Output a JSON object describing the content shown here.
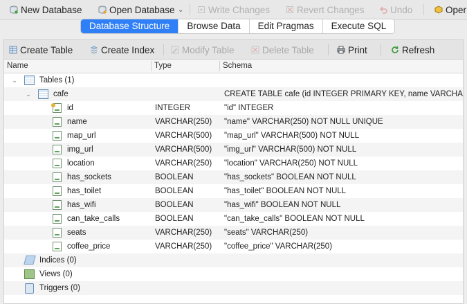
{
  "toolbar": {
    "new_database": "New Database",
    "open_database": "Open Database",
    "write_changes": "Write Changes",
    "revert_changes": "Revert Changes",
    "undo": "Undo",
    "open_project": "Oper"
  },
  "tabs": [
    "Database Structure",
    "Browse Data",
    "Edit Pragmas",
    "Execute SQL"
  ],
  "structure_toolbar": {
    "create_table": "Create Table",
    "create_index": "Create Index",
    "modify_table": "Modify Table",
    "delete_table": "Delete Table",
    "print": "Print",
    "refresh": "Refresh"
  },
  "columns": {
    "name": "Name",
    "type": "Type",
    "schema": "Schema"
  },
  "tree": {
    "tables_label": "Tables (1)",
    "table": {
      "name": "cafe",
      "schema": "CREATE TABLE cafe (id INTEGER PRIMARY KEY, name VARCHAR(250) N"
    },
    "fields": [
      {
        "name": "id",
        "type": "INTEGER",
        "schema": "\"id\" INTEGER",
        "key": true
      },
      {
        "name": "name",
        "type": "VARCHAR(250)",
        "schema": "\"name\" VARCHAR(250) NOT NULL UNIQUE",
        "key": false
      },
      {
        "name": "map_url",
        "type": "VARCHAR(500)",
        "schema": "\"map_url\" VARCHAR(500) NOT NULL",
        "key": false
      },
      {
        "name": "img_url",
        "type": "VARCHAR(500)",
        "schema": "\"img_url\" VARCHAR(500) NOT NULL",
        "key": false
      },
      {
        "name": "location",
        "type": "VARCHAR(250)",
        "schema": "\"location\" VARCHAR(250) NOT NULL",
        "key": false
      },
      {
        "name": "has_sockets",
        "type": "BOOLEAN",
        "schema": "\"has_sockets\" BOOLEAN NOT NULL",
        "key": false
      },
      {
        "name": "has_toilet",
        "type": "BOOLEAN",
        "schema": "\"has_toilet\" BOOLEAN NOT NULL",
        "key": false
      },
      {
        "name": "has_wifi",
        "type": "BOOLEAN",
        "schema": "\"has_wifi\" BOOLEAN NOT NULL",
        "key": false
      },
      {
        "name": "can_take_calls",
        "type": "BOOLEAN",
        "schema": "\"can_take_calls\" BOOLEAN NOT NULL",
        "key": false
      },
      {
        "name": "seats",
        "type": "VARCHAR(250)",
        "schema": "\"seats\" VARCHAR(250)",
        "key": false
      },
      {
        "name": "coffee_price",
        "type": "VARCHAR(250)",
        "schema": "\"coffee_price\" VARCHAR(250)",
        "key": false
      }
    ],
    "indices_label": "Indices (0)",
    "views_label": "Views (0)",
    "triggers_label": "Triggers (0)"
  },
  "colors": {
    "accent": "#2f7ff7",
    "disabled_text": "#b0b0b0"
  }
}
